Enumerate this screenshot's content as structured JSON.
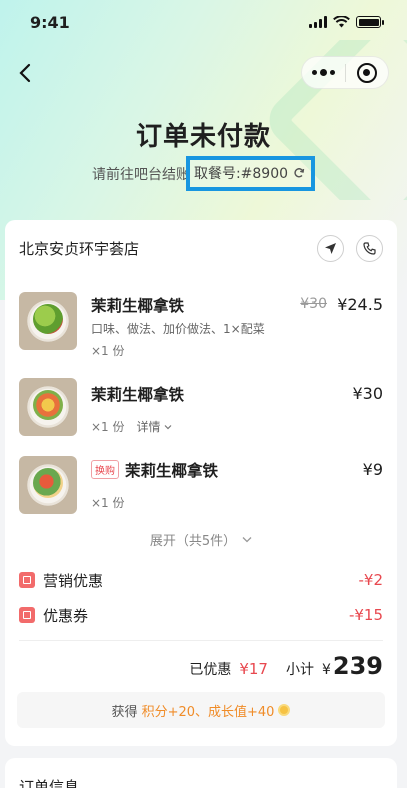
{
  "status_bar": {
    "time": "9:41"
  },
  "header": {
    "title": "订单未付款",
    "subtitle": "请前往吧台结账",
    "pickup_label": "取餐号:#8900"
  },
  "store": {
    "name": "北京安贞环宇荟店"
  },
  "items": [
    {
      "name": "茉莉生椰拿铁",
      "desc": "口味、做法、加价做法、1×配菜",
      "qty": "×1 份",
      "orig_price": "¥30",
      "price": "¥24.5"
    },
    {
      "name": "茉莉生椰拿铁",
      "qty": "×1 份",
      "detail": "详情",
      "price": "¥30"
    },
    {
      "tag": "换购",
      "name": "茉莉生椰拿铁",
      "qty": "×1 份",
      "price": "¥9"
    }
  ],
  "expand_label": "展开（共5件）",
  "discounts": [
    {
      "label": "营销优惠",
      "value": "-¥2"
    },
    {
      "label": "优惠券",
      "value": "-¥15"
    }
  ],
  "totals": {
    "saved_label": "已优惠",
    "saved_value": "¥17",
    "subtotal_label": "小计",
    "subtotal_currency": "¥",
    "subtotal_value": "239"
  },
  "points": {
    "prefix": "获得",
    "points_text": "积分+20、成长值+40"
  },
  "order_info": {
    "title": "订单信息"
  },
  "colors": {
    "accent_red": "#e8484f",
    "highlight_box": "#1896e0",
    "points_orange": "#f08c28"
  }
}
